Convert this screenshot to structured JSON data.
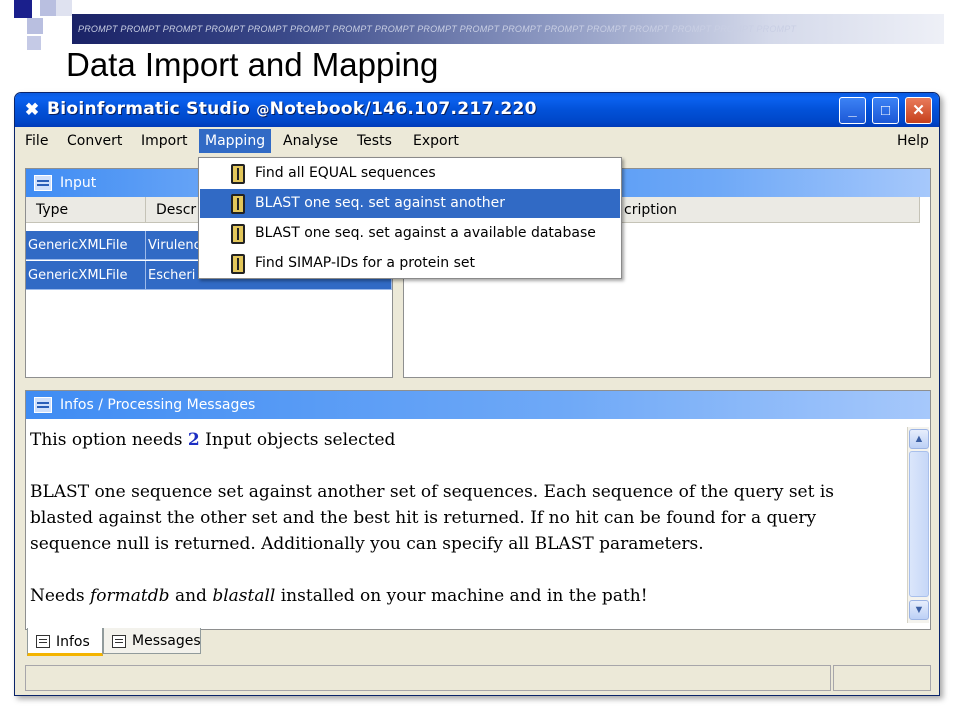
{
  "slide": {
    "banner_text": "PROMPT PROMPT PROMPT PROMPT PROMPT PROMPT PROMPT PROMPT PROMPT PROMPT PROMPT PROMPT PROMPT PROMPT PROMPT PROMPT PROMPT",
    "title": "Data Import and Mapping",
    "colors": {
      "square_dark": "#1a1f8c",
      "square_light": "#b9bfe0"
    }
  },
  "window": {
    "app_name": "Bioinformatic Studio",
    "at_symbol": "@",
    "location": "Notebook/146.107.217.220",
    "controls": {
      "minimize": "_",
      "maximize": "□",
      "close": "✕"
    }
  },
  "menubar": {
    "items": [
      "File",
      "Convert",
      "Import",
      "Mapping",
      "Analyse",
      "Tests",
      "Export"
    ],
    "help": "Help",
    "active": "Mapping"
  },
  "mapping_menu": {
    "items": [
      {
        "label": "Find all EQUAL sequences",
        "icon": "equal-sequences-icon"
      },
      {
        "label": "BLAST one seq. set against another",
        "icon": "blast-icon",
        "highlighted": true
      },
      {
        "label": "BLAST one seq. set against a available database",
        "icon": "blast-database-icon"
      },
      {
        "label": "Find SIMAP-IDs for a protein set",
        "icon": "simap-icon"
      }
    ]
  },
  "input_panel": {
    "title": "Input",
    "columns": [
      "Type",
      "Descr"
    ],
    "rows": [
      {
        "type": "GenericXMLFile",
        "description": "Virulenc"
      },
      {
        "type": "GenericXMLFile",
        "description": "Escheri"
      }
    ]
  },
  "output_panel": {
    "columns": [
      "cription"
    ]
  },
  "infos_panel": {
    "title": "Infos / Processing Messages",
    "line1_pre": "This option needs",
    "line1_num": "2",
    "line1_post": "Input objects selected",
    "paragraph2": "BLAST one sequence set against another set of sequences. Each sequence of the query set is blasted against the other set and the best hit is returned. If no hit can be found for a query sequence null is returned. Additionally you can specify all BLAST parameters.",
    "line3_pre": "Needs",
    "line3_tool1": "formatdb",
    "line3_mid": "and",
    "line3_tool2": "blastall",
    "line3_post": "installed on your machine and in the path!"
  },
  "tabs": [
    {
      "label": "Infos",
      "active": true
    },
    {
      "label": "Messages",
      "active": false
    }
  ]
}
